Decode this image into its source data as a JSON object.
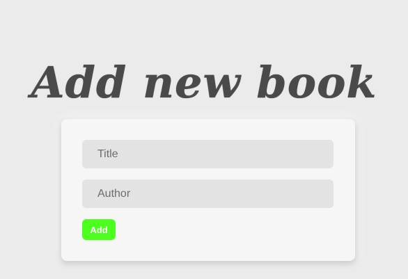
{
  "page": {
    "title": "Add new book"
  },
  "form": {
    "title_field": {
      "placeholder": "Title",
      "value": ""
    },
    "author_field": {
      "placeholder": "Author",
      "value": ""
    },
    "add_label": "Add"
  },
  "colors": {
    "background": "#ebebeb",
    "card": "#f6f6f6",
    "field": "#e3e3e3",
    "button": "#4cff1f",
    "title_text": "#4a4a4a"
  }
}
